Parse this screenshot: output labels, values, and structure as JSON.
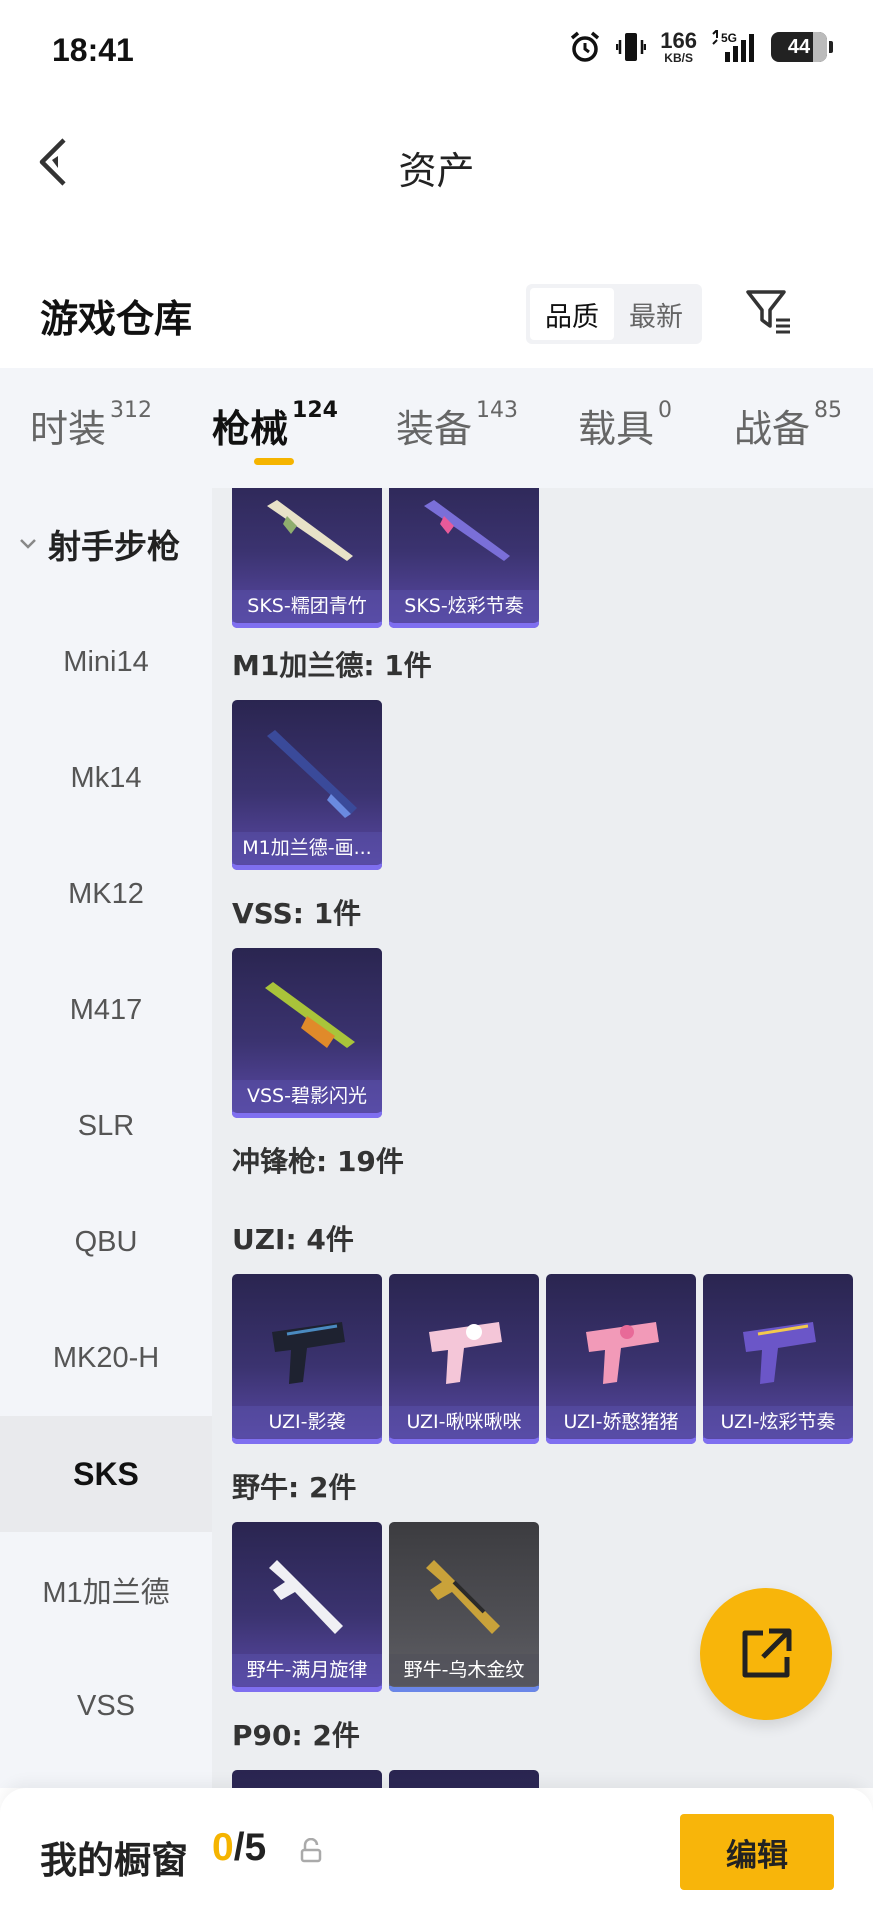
{
  "status_bar": {
    "time": "18:41",
    "net_speed_value": "166",
    "net_speed_unit": "KB/S",
    "network": "5G",
    "battery": "44",
    "icons": [
      "alarm-icon",
      "vibrate-icon",
      "signal-icon",
      "battery-icon"
    ]
  },
  "header": {
    "title": "资产",
    "back_icon": "chevron-left-icon"
  },
  "warehouse": {
    "title": "游戏仓库",
    "sort_options": [
      "品质",
      "最新"
    ],
    "sort_selected": "品质",
    "filter_icon": "filter-icon"
  },
  "tabs": [
    {
      "label": "时装",
      "count": "312"
    },
    {
      "label": "枪械",
      "count": "124"
    },
    {
      "label": "装备",
      "count": "143"
    },
    {
      "label": "载具",
      "count": "0"
    },
    {
      "label": "战备",
      "count": "85"
    }
  ],
  "active_tab": "枪械",
  "sidebar": {
    "group_label": "射手步枪",
    "items": [
      "Mini14",
      "Mk14",
      "MK12",
      "M417",
      "SLR",
      "QBU",
      "MK20-H",
      "SKS",
      "M1加兰德",
      "VSS"
    ],
    "active_item": "SKS"
  },
  "content": {
    "sks_cards": [
      "SKS-糯团青竹",
      "SKS-炫彩节奏"
    ],
    "m1_label": "M1加兰德: 1件",
    "m1_cards": [
      "M1加兰德-画..."
    ],
    "vss_label": "VSS: 1件",
    "vss_cards": [
      "VSS-碧影闪光"
    ],
    "smg_label": "冲锋枪: 19件",
    "uzi_label": "UZI: 4件",
    "uzi_cards": [
      "UZI-影袭",
      "UZI-啾咪啾咪",
      "UZI-娇憨猪猪",
      "UZI-炫彩节奏"
    ],
    "bison_label": "野牛: 2件",
    "bison_cards": [
      "野牛-满月旋律",
      "野牛-乌木金纹"
    ],
    "p90_label": "P90: 2件"
  },
  "bottom_bar": {
    "label": "我的橱窗",
    "current": "0",
    "separator_total": "/5",
    "edit_label": "编辑"
  },
  "colors": {
    "accent": "#f8b50a",
    "card_purple": "#3b3370",
    "card_gray": "#505055"
  }
}
